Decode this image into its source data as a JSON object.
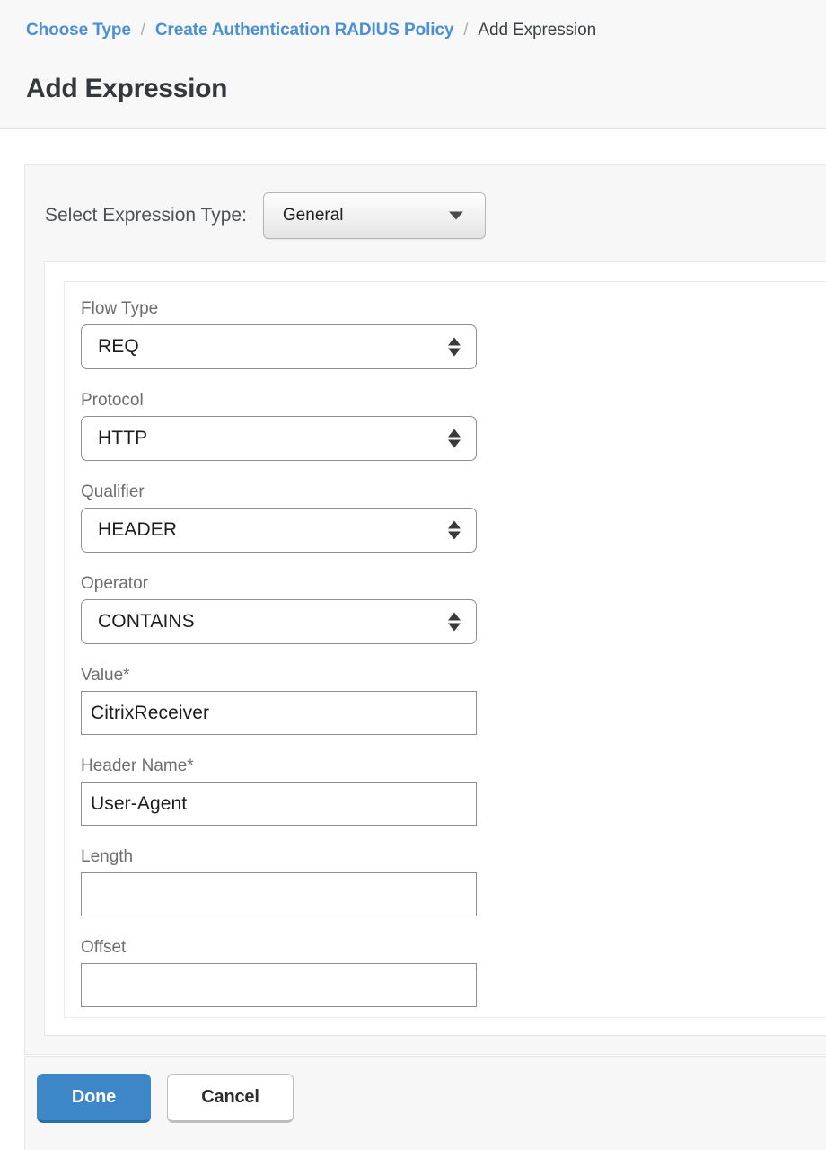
{
  "header": {
    "breadcrumb": [
      {
        "label": "Choose Type",
        "is_link": true
      },
      {
        "label": "Create Authentication RADIUS Policy",
        "is_link": true
      },
      {
        "label": "Add Expression",
        "is_link": false
      }
    ],
    "separator": "/",
    "title": "Add Expression",
    "link_color": "#4a90d2",
    "title_color": "#33383d"
  },
  "expression_type": {
    "label": "Select Expression Type:",
    "selected": "General",
    "caret_icon": "chevron-down-icon"
  },
  "fields": [
    {
      "name": "flow-type",
      "label": "Flow Type",
      "control": "select",
      "value": "REQ"
    },
    {
      "name": "protocol",
      "label": "Protocol",
      "control": "select",
      "value": "HTTP"
    },
    {
      "name": "qualifier",
      "label": "Qualifier",
      "control": "select",
      "value": "HEADER"
    },
    {
      "name": "operator",
      "label": "Operator",
      "control": "select",
      "value": "CONTAINS"
    },
    {
      "name": "value",
      "label": "Value*",
      "control": "text",
      "value": "CitrixReceiver"
    },
    {
      "name": "header-name",
      "label": "Header Name*",
      "control": "text",
      "value": "User-Agent"
    },
    {
      "name": "length",
      "label": "Length",
      "control": "text",
      "value": ""
    },
    {
      "name": "offset",
      "label": "Offset",
      "control": "text",
      "value": ""
    }
  ],
  "footer": {
    "done_label": "Done",
    "cancel_label": "Cancel",
    "primary_color": "#3d87c8"
  }
}
